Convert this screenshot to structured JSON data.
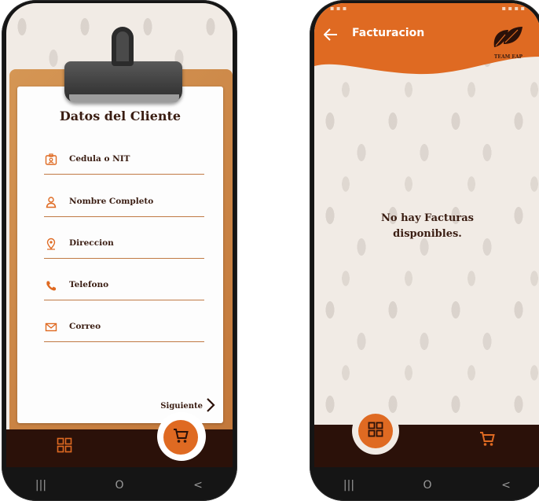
{
  "colors": {
    "accent": "#df6a22",
    "dark_brown": "#2b1109",
    "text_brown": "#3a1d12"
  },
  "left": {
    "form_title": "Datos del Cliente",
    "fields": [
      {
        "label": "Cedula o NIT",
        "icon": "id-card-icon"
      },
      {
        "label": "Nombre Completo",
        "icon": "person-icon"
      },
      {
        "label": "Direccion",
        "icon": "location-pin-icon"
      },
      {
        "label": "Telefono",
        "icon": "phone-icon"
      },
      {
        "label": "Correo",
        "icon": "mail-icon"
      }
    ],
    "next_label": "Siguiente",
    "nav": [
      "|||",
      "O",
      "<"
    ]
  },
  "right": {
    "title": "Facturacion",
    "logo_text": "TEAM EAP",
    "empty_message": "No hay Facturas\ndisponibles.",
    "nav": [
      "|||",
      "O",
      "<"
    ]
  }
}
